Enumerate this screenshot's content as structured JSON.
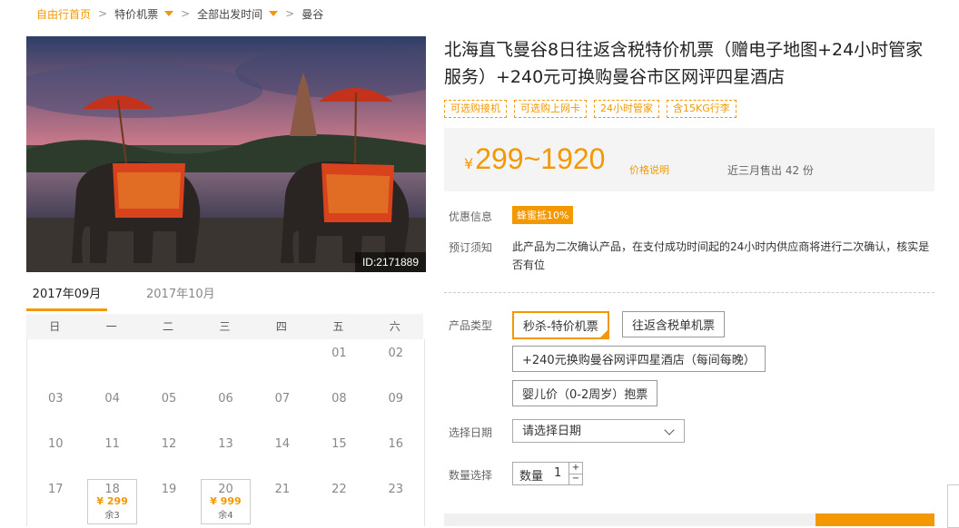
{
  "breadcrumb": {
    "home": "自由行首页",
    "item1": "特价机票",
    "item2": "全部出发时间",
    "item3": "曼谷"
  },
  "hero": {
    "id_label": "ID:2171889"
  },
  "product": {
    "title": "北海直飞曼谷8日往返含税特价机票（赠电子地图+24小时管家服务）+240元可换购曼谷市区网评四星酒店",
    "tags": [
      "可选购接机",
      "可选购上网卡",
      "24小时管家",
      "含15KG行李"
    ],
    "price_currency": "¥",
    "price_range": "299~1920",
    "price_note": "价格说明",
    "sold_text": "近三月售出 42 份"
  },
  "info": {
    "discount_label": "优惠信息",
    "discount_badge": "蜂蜜抵10%",
    "notice_label": "预订须知",
    "notice_text": "此产品为二次确认产品，在支付成功时间起的24小时内供应商将进行二次确认，核实是否有位"
  },
  "options": {
    "type_label": "产品类型",
    "types": [
      "秒杀-特价机票",
      "往返含税单机票",
      "+240元换购曼谷网评四星酒店（每间每晚）",
      "婴儿价（0-2周岁）抱票"
    ],
    "date_label": "选择日期",
    "date_placeholder": "请选择日期",
    "qty_label": "数量选择",
    "qty_prefix": "数量",
    "qty_value": "1",
    "qty_plus": "+",
    "qty_minus": "−"
  },
  "calendar": {
    "tabs": [
      "2017年09月",
      "2017年10月"
    ],
    "weekdays": [
      "日",
      "一",
      "二",
      "三",
      "四",
      "五",
      "六"
    ],
    "rows": [
      [
        "",
        "",
        "",
        "",
        "",
        "01",
        "02"
      ],
      [
        "03",
        "04",
        "05",
        "06",
        "07",
        "08",
        "09"
      ],
      [
        "10",
        "11",
        "12",
        "13",
        "14",
        "15",
        "16"
      ],
      [
        "17",
        "18",
        "19",
        "20",
        "21",
        "22",
        "23"
      ]
    ],
    "priced": [
      {
        "day": "18",
        "price": "¥ 299",
        "remain": "余3"
      },
      {
        "day": "20",
        "price": "¥ 999",
        "remain": "余4"
      }
    ]
  },
  "colors": {
    "accent": "#f39800"
  }
}
